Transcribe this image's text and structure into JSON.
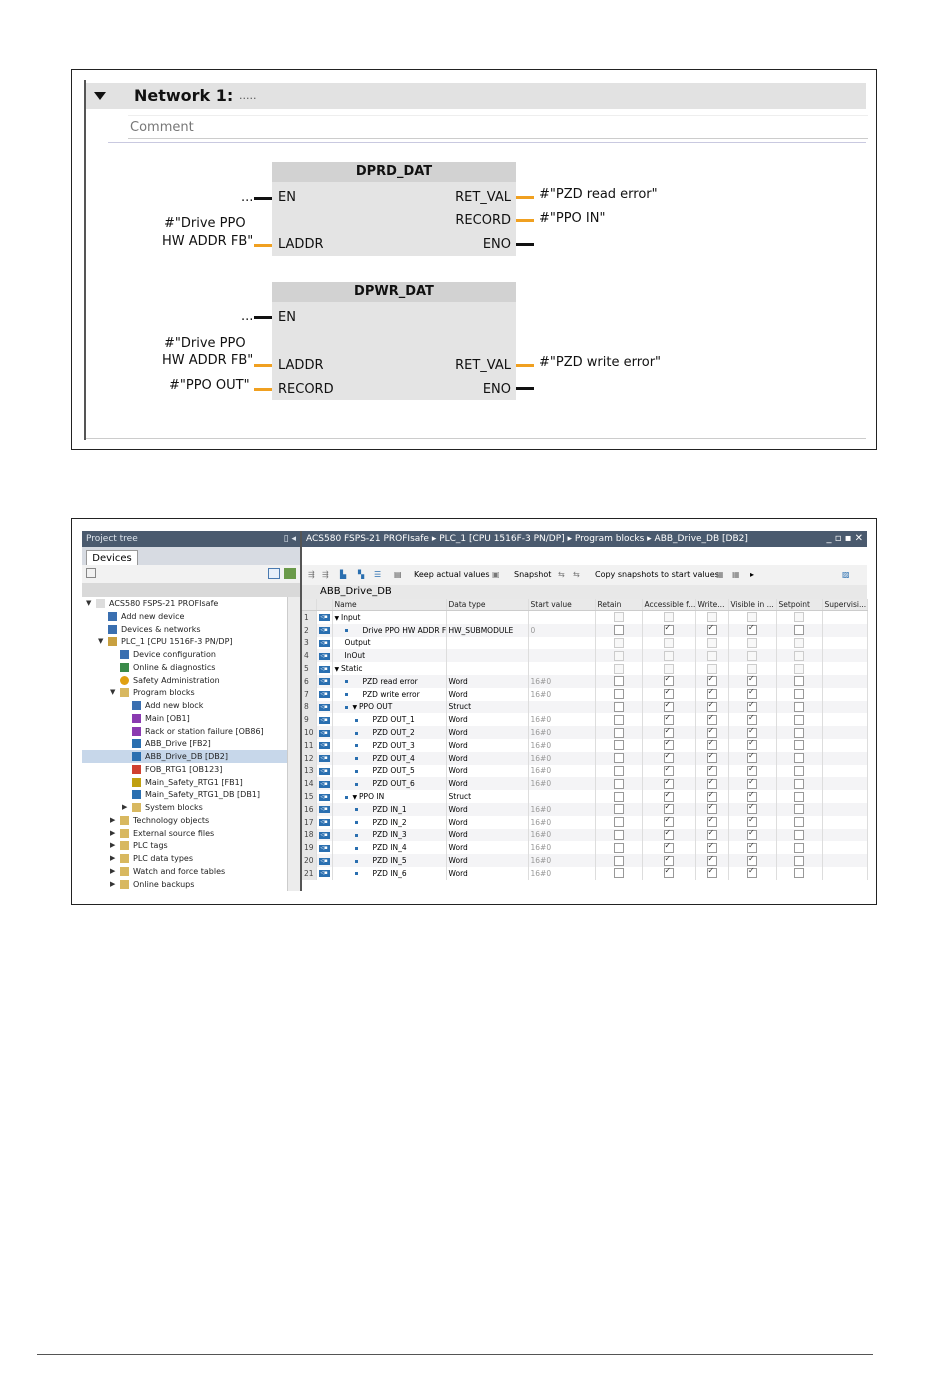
{
  "fig1": {
    "network_title": "Network 1:",
    "network_dots": ".....",
    "comment": "Comment",
    "block1": {
      "name": "DPRD_DAT",
      "pins_left": [
        "EN",
        "LADDR"
      ],
      "pins_right": [
        "RET_VAL",
        "RECORD",
        "ENO"
      ],
      "en_operand": "...",
      "laddr_operand_line1": "#\"Drive PPO",
      "laddr_operand_line2": "HW ADDR FB\"",
      "retval_operand": "#\"PZD read error\"",
      "record_operand": "#\"PPO IN\""
    },
    "block2": {
      "name": "DPWR_DAT",
      "pins_left": [
        "EN",
        "LADDR",
        "RECORD"
      ],
      "pins_right": [
        "RET_VAL",
        "ENO"
      ],
      "en_operand": "...",
      "laddr_operand_line1": "#\"Drive PPO",
      "laddr_operand_line2": "HW ADDR FB\"",
      "record_operand": "#\"PPO OUT\"",
      "retval_operand": "#\"PZD write error\""
    },
    "colors": {
      "wire_bool": "#111111",
      "wire_data": "#f0a020",
      "block_fill": "#e4e4e4",
      "block_header": "#d2d2d2"
    }
  },
  "fig2": {
    "project_tree": {
      "title": "Project tree",
      "tab": "Devices",
      "items": [
        {
          "label": "ACS580 FSPS-21 PROFIsafe",
          "icon": "project-icon",
          "indent": 0,
          "arrow": "down"
        },
        {
          "label": "Add new device",
          "icon": "add-device-icon",
          "indent": 1,
          "arrow": ""
        },
        {
          "label": "Devices & networks",
          "icon": "network-icon",
          "indent": 1,
          "arrow": ""
        },
        {
          "label": "PLC_1 [CPU 1516F-3 PN/DP]",
          "icon": "plc-icon",
          "indent": 1,
          "arrow": "down"
        },
        {
          "label": "Device configuration",
          "icon": "device-config-icon",
          "indent": 2,
          "arrow": ""
        },
        {
          "label": "Online & diagnostics",
          "icon": "diagnostics-icon",
          "indent": 2,
          "arrow": ""
        },
        {
          "label": "Safety Administration",
          "icon": "safety-icon",
          "indent": 2,
          "arrow": ""
        },
        {
          "label": "Program blocks",
          "icon": "folder-icon",
          "indent": 2,
          "arrow": "down"
        },
        {
          "label": "Add new block",
          "icon": "add-block-icon",
          "indent": 3,
          "arrow": ""
        },
        {
          "label": "Main [OB1]",
          "icon": "ob-icon",
          "indent": 3,
          "arrow": ""
        },
        {
          "label": "Rack or station failure [OB86]",
          "icon": "ob-icon",
          "indent": 3,
          "arrow": ""
        },
        {
          "label": "ABB_Drive [FB2]",
          "icon": "fb-icon",
          "indent": 3,
          "arrow": ""
        },
        {
          "label": "ABB_Drive_DB [DB2]",
          "icon": "db-icon",
          "indent": 3,
          "arrow": "",
          "selected": true
        },
        {
          "label": "FOB_RTG1 [OB123]",
          "icon": "ob-safety-icon",
          "indent": 3,
          "arrow": ""
        },
        {
          "label": "Main_Safety_RTG1 [FB1]",
          "icon": "fb-safety-icon",
          "indent": 3,
          "arrow": ""
        },
        {
          "label": "Main_Safety_RTG1_DB [DB1]",
          "icon": "db-icon",
          "indent": 3,
          "arrow": ""
        },
        {
          "label": "System blocks",
          "icon": "folder-icon",
          "indent": 3,
          "arrow": "right"
        },
        {
          "label": "Technology objects",
          "icon": "folder-icon",
          "indent": 2,
          "arrow": "right"
        },
        {
          "label": "External source files",
          "icon": "folder-icon",
          "indent": 2,
          "arrow": "right"
        },
        {
          "label": "PLC tags",
          "icon": "folder-icon",
          "indent": 2,
          "arrow": "right"
        },
        {
          "label": "PLC data types",
          "icon": "folder-icon",
          "indent": 2,
          "arrow": "right"
        },
        {
          "label": "Watch and force tables",
          "icon": "folder-icon",
          "indent": 2,
          "arrow": "right"
        },
        {
          "label": "Online backups",
          "icon": "folder-icon",
          "indent": 2,
          "arrow": "right"
        }
      ]
    },
    "editor": {
      "breadcrumb": "ACS580 FSPS-21 PROFIsafe  ▸  PLC_1 [CPU 1516F-3 PN/DP]  ▸  Program blocks  ▸  ABB_Drive_DB [DB2]",
      "window_controls": "_ ▫ ▪ ✕",
      "toolbar": {
        "keep_actual": "Keep actual values",
        "snapshot": "Snapshot",
        "copy_snapshots": "Copy snapshots to start values"
      },
      "db_name": "ABB_Drive_DB",
      "columns": [
        "",
        "Name",
        "Data type",
        "Start value",
        "Retain",
        "Accessible f...",
        "Write...",
        "Visible in ...",
        "Setpoint",
        "Supervisi..."
      ],
      "rows": [
        {
          "n": "1",
          "arrow": "▼",
          "bullet": false,
          "lvl": 0,
          "name": "Input",
          "type": "",
          "start": "",
          "acc": false,
          "wr": false,
          "vis": false,
          "dis": true
        },
        {
          "n": "2",
          "arrow": "",
          "bullet": true,
          "lvl": 1,
          "name": "Drive PPO HW ADDR FB",
          "type": "HW_SUBMODULE",
          "start": "0",
          "acc": true,
          "wr": true,
          "vis": true,
          "dis": false
        },
        {
          "n": "3",
          "arrow": "",
          "bullet": false,
          "lvl": 0,
          "name": "Output",
          "type": "",
          "start": "",
          "acc": false,
          "wr": false,
          "vis": false,
          "dis": true
        },
        {
          "n": "4",
          "arrow": "",
          "bullet": false,
          "lvl": 0,
          "name": "InOut",
          "type": "",
          "start": "",
          "acc": false,
          "wr": false,
          "vis": false,
          "dis": true
        },
        {
          "n": "5",
          "arrow": "▼",
          "bullet": false,
          "lvl": 0,
          "name": "Static",
          "type": "",
          "start": "",
          "acc": false,
          "wr": false,
          "vis": false,
          "dis": true
        },
        {
          "n": "6",
          "arrow": "",
          "bullet": true,
          "lvl": 1,
          "name": "PZD read error",
          "type": "Word",
          "start": "16#0",
          "acc": true,
          "wr": true,
          "vis": true,
          "dis": false
        },
        {
          "n": "7",
          "arrow": "",
          "bullet": true,
          "lvl": 1,
          "name": "PZD write error",
          "type": "Word",
          "start": "16#0",
          "acc": true,
          "wr": true,
          "vis": true,
          "dis": false
        },
        {
          "n": "8",
          "arrow": "▼",
          "bullet": true,
          "lvl": 1,
          "name": "PPO OUT",
          "type": "Struct",
          "start": "",
          "acc": true,
          "wr": true,
          "vis": true,
          "dis": false
        },
        {
          "n": "9",
          "arrow": "",
          "bullet": true,
          "lvl": 2,
          "name": "PZD OUT_1",
          "type": "Word",
          "start": "16#0",
          "acc": true,
          "wr": true,
          "vis": true,
          "dis": false
        },
        {
          "n": "10",
          "arrow": "",
          "bullet": true,
          "lvl": 2,
          "name": "PZD OUT_2",
          "type": "Word",
          "start": "16#0",
          "acc": true,
          "wr": true,
          "vis": true,
          "dis": false
        },
        {
          "n": "11",
          "arrow": "",
          "bullet": true,
          "lvl": 2,
          "name": "PZD OUT_3",
          "type": "Word",
          "start": "16#0",
          "acc": true,
          "wr": true,
          "vis": true,
          "dis": false
        },
        {
          "n": "12",
          "arrow": "",
          "bullet": true,
          "lvl": 2,
          "name": "PZD OUT_4",
          "type": "Word",
          "start": "16#0",
          "acc": true,
          "wr": true,
          "vis": true,
          "dis": false
        },
        {
          "n": "13",
          "arrow": "",
          "bullet": true,
          "lvl": 2,
          "name": "PZD OUT_5",
          "type": "Word",
          "start": "16#0",
          "acc": true,
          "wr": true,
          "vis": true,
          "dis": false
        },
        {
          "n": "14",
          "arrow": "",
          "bullet": true,
          "lvl": 2,
          "name": "PZD OUT_6",
          "type": "Word",
          "start": "16#0",
          "acc": true,
          "wr": true,
          "vis": true,
          "dis": false
        },
        {
          "n": "15",
          "arrow": "▼",
          "bullet": true,
          "lvl": 1,
          "name": "PPO IN",
          "type": "Struct",
          "start": "",
          "acc": true,
          "wr": true,
          "vis": true,
          "dis": false
        },
        {
          "n": "16",
          "arrow": "",
          "bullet": true,
          "lvl": 2,
          "name": "PZD IN_1",
          "type": "Word",
          "start": "16#0",
          "acc": true,
          "wr": true,
          "vis": true,
          "dis": false
        },
        {
          "n": "17",
          "arrow": "",
          "bullet": true,
          "lvl": 2,
          "name": "PZD IN_2",
          "type": "Word",
          "start": "16#0",
          "acc": true,
          "wr": true,
          "vis": true,
          "dis": false
        },
        {
          "n": "18",
          "arrow": "",
          "bullet": true,
          "lvl": 2,
          "name": "PZD IN_3",
          "type": "Word",
          "start": "16#0",
          "acc": true,
          "wr": true,
          "vis": true,
          "dis": false
        },
        {
          "n": "19",
          "arrow": "",
          "bullet": true,
          "lvl": 2,
          "name": "PZD IN_4",
          "type": "Word",
          "start": "16#0",
          "acc": true,
          "wr": true,
          "vis": true,
          "dis": false
        },
        {
          "n": "20",
          "arrow": "",
          "bullet": true,
          "lvl": 2,
          "name": "PZD IN_5",
          "type": "Word",
          "start": "16#0",
          "acc": true,
          "wr": true,
          "vis": true,
          "dis": false
        },
        {
          "n": "21",
          "arrow": "",
          "bullet": true,
          "lvl": 2,
          "name": "PZD IN_6",
          "type": "Word",
          "start": "16#0",
          "acc": true,
          "wr": true,
          "vis": true,
          "dis": false
        }
      ]
    },
    "colors": {
      "title_bar": "#4a5a6e",
      "selection": "#c7d7ea",
      "accent": "#2a6fb0"
    }
  }
}
